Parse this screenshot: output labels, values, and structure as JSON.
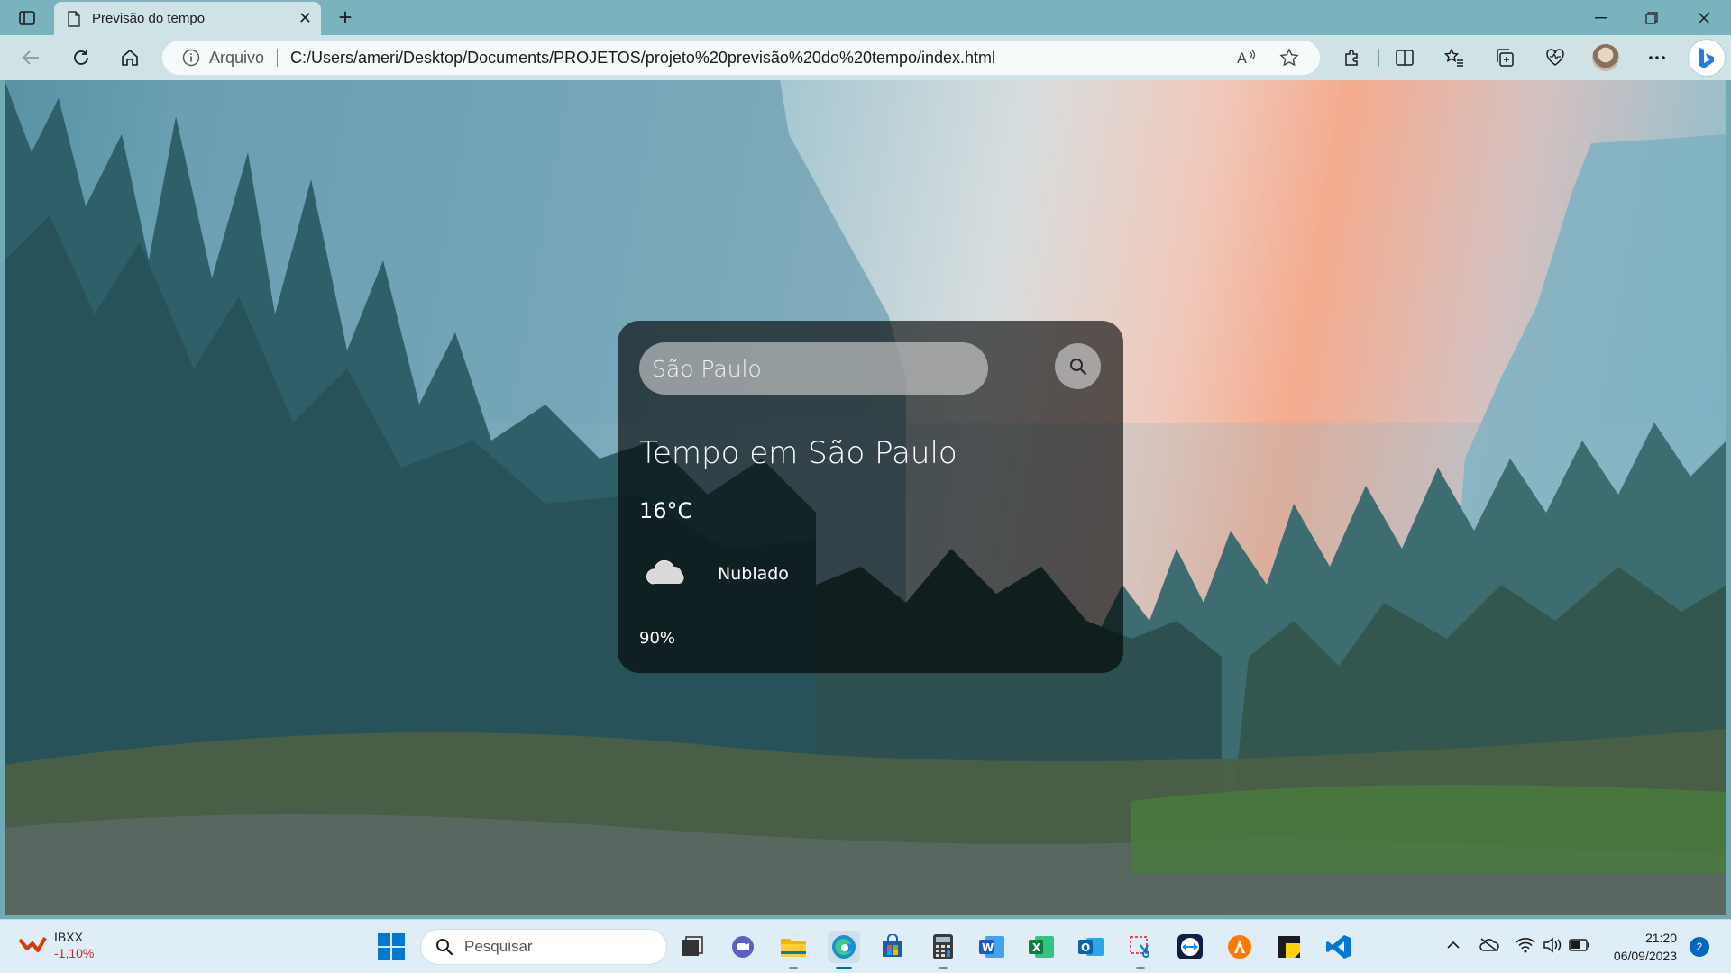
{
  "browser": {
    "tab_title": "Previsão do tempo",
    "address_scheme": "Arquivo",
    "address_url": "C:/Users/ameri/Desktop/Documents/PROJETOS/projeto%20previsão%20do%20tempo/index.html"
  },
  "weather": {
    "search_value": "São Paulo",
    "title": "Tempo em São Paulo",
    "temperature": "16°C",
    "description": "Nublado",
    "humidity": "90%",
    "icon": "cloud-icon"
  },
  "taskbar": {
    "stock_name": "IBXX",
    "stock_change": "-1,10%",
    "search_placeholder": "Pesquisar",
    "time": "21:20",
    "date": "06/09/2023",
    "notification_count": "2",
    "apps": [
      "task-view",
      "teams-chat",
      "file-explorer",
      "edge",
      "microsoft-store",
      "calculator",
      "word",
      "excel",
      "outlook",
      "snipping-tool",
      "teamviewer",
      "avast",
      "sticky-notes",
      "vscode"
    ]
  },
  "colors": {
    "card_background": "#000000",
    "accent": "#0067c0",
    "stock_negative": "#c42b1c"
  }
}
